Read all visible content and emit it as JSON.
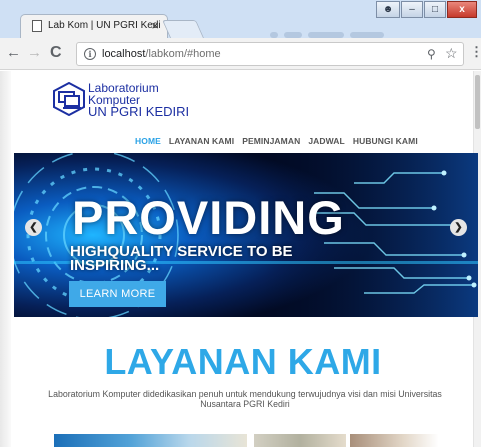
{
  "browser": {
    "tab_title": "Lab Kom | UN PGRI Kediri",
    "tab_close": "×",
    "url_host": "localhost",
    "url_path": "/labkom/#home",
    "window_buttons": {
      "minimize": "–",
      "maximize": "□",
      "close": "x"
    },
    "icons": [
      "page-icon",
      "back-icon",
      "forward-icon",
      "reload-icon",
      "info-icon",
      "zoom-icon",
      "star-icon",
      "menu-icon"
    ]
  },
  "logo": {
    "line1": "Laboratorium",
    "line2": "Komputer",
    "line3": "UN PGRI KEDIRI"
  },
  "nav": {
    "items": [
      {
        "label": "HOME",
        "active": true
      },
      {
        "label": "LAYANAN KAMI",
        "active": false
      },
      {
        "label": "PEMINJAMAN",
        "active": false
      },
      {
        "label": "JADWAL",
        "active": false
      },
      {
        "label": "HUBUNGI KAMI",
        "active": false
      }
    ]
  },
  "hero": {
    "title": "PROVIDING",
    "subtitle": "HIGHQUALITY SERVICE TO BE INSPIRING...",
    "button": "LEARN MORE",
    "prev": "❮",
    "next": "❯"
  },
  "services": {
    "heading": "LAYANAN KAMI",
    "description": "Laboratorium Komputer didedikasikan penuh untuk mendukung terwujudnya visi dan misi Universitas Nusantara PGRI Kediri"
  },
  "colors": {
    "accent": "#2ea8e7",
    "logo_blue": "#1c2fa2",
    "hero_bg": "#020a23",
    "button": "#3fa9e8"
  }
}
